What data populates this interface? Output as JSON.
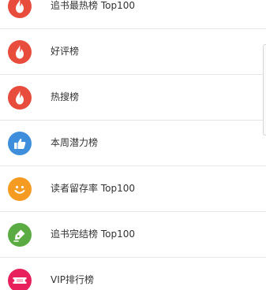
{
  "rankings": {
    "items": [
      {
        "label": "追书最热榜 Top100",
        "icon": "flame-icon",
        "color": "#e84c3d"
      },
      {
        "label": "好评榜",
        "icon": "flame-icon",
        "color": "#e84c3d"
      },
      {
        "label": "热搜榜",
        "icon": "flame-icon",
        "color": "#e84c3d"
      },
      {
        "label": "本周潜力榜",
        "icon": "thumbs-up-icon",
        "color": "#3f8edc"
      },
      {
        "label": "读者留存率 Top100",
        "icon": "smiley-icon",
        "color": "#f59b22"
      },
      {
        "label": "追书完结榜 Top100",
        "icon": "pen-icon",
        "color": "#5aab41"
      },
      {
        "label": "VIP排行榜",
        "icon": "vip-ticket-icon",
        "color": "#e8215d"
      }
    ]
  }
}
